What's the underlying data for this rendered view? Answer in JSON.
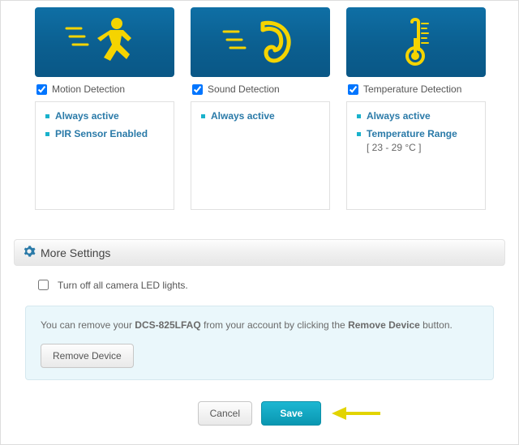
{
  "detections": [
    {
      "label": "Motion Detection",
      "icon": "motion",
      "items": [
        {
          "label": "Always active",
          "sub": null
        },
        {
          "label": "PIR Sensor Enabled",
          "sub": null
        }
      ]
    },
    {
      "label": "Sound Detection",
      "icon": "sound",
      "items": [
        {
          "label": "Always active",
          "sub": null
        }
      ]
    },
    {
      "label": "Temperature Detection",
      "icon": "temperature",
      "items": [
        {
          "label": "Always active",
          "sub": null
        },
        {
          "label": "Temperature Range",
          "sub": "[ 23 - 29 °C ]"
        }
      ]
    }
  ],
  "more_settings_label": "More Settings",
  "led_checkbox_label": "Turn off all camera LED lights.",
  "remove_text_pre": "You can remove your ",
  "device_name": "DCS-825LFAQ",
  "remove_text_mid": " from your account by clicking the ",
  "remove_text_bold": "Remove Device",
  "remove_text_post": " button.",
  "remove_button_label": "Remove Device",
  "cancel_label": "Cancel",
  "save_label": "Save"
}
